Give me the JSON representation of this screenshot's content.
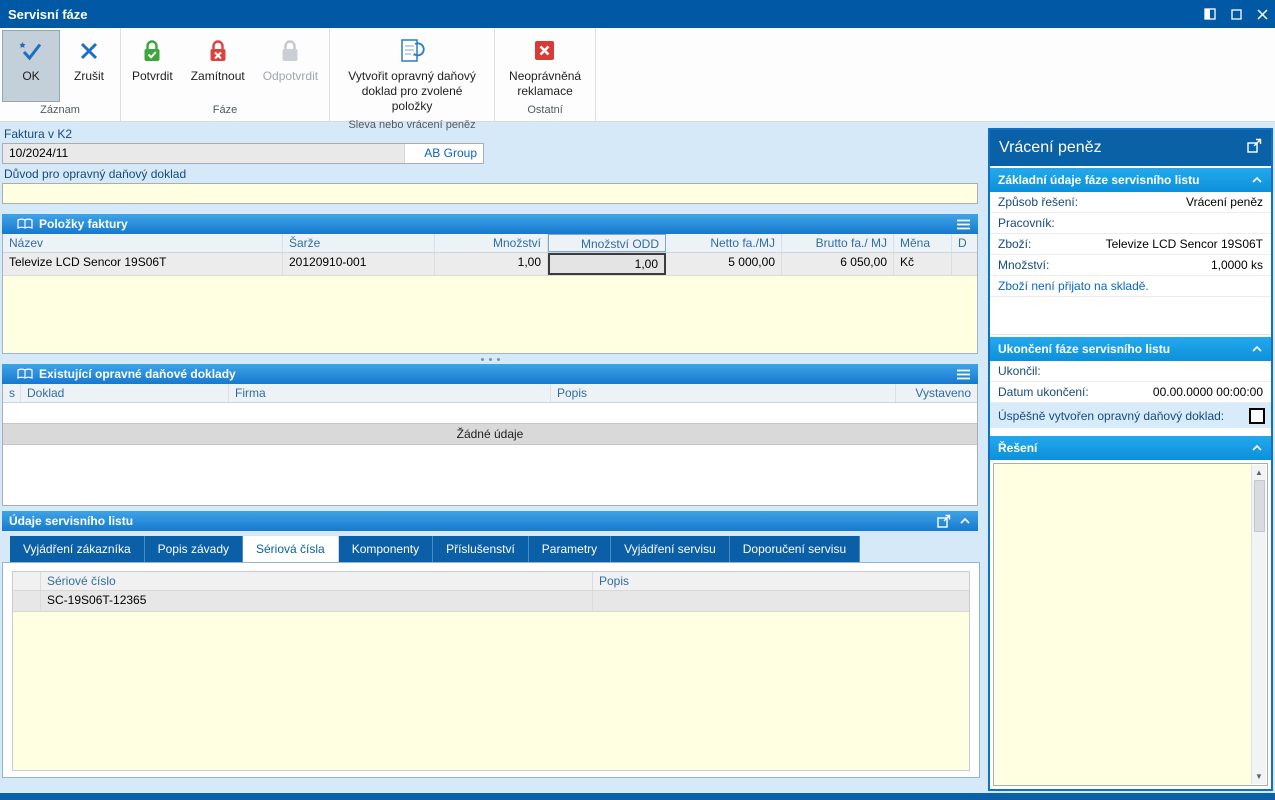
{
  "window": {
    "title": "Servisní fáze"
  },
  "ribbon": {
    "ok": "OK",
    "cancel": "Zrušit",
    "confirm": "Potvrdit",
    "reject": "Zamítnout",
    "unconfirm": "Odpotvrdit",
    "create_doc": "Vytvořit opravný daňový doklad pro zvolené položky",
    "unauthorized": "Neoprávněná reklamace",
    "group_record": "Záznam",
    "group_phase": "Fáze",
    "group_refund": "Sleva nebo vrácení peněz",
    "group_other": "Ostatní"
  },
  "invoice": {
    "label": "Faktura v K2",
    "number": "10/2024/11",
    "company": "AB Group",
    "reason_label": "Důvod pro opravný daňový doklad",
    "reason_value": ""
  },
  "items": {
    "title": "Položky faktury",
    "columns": [
      "Název",
      "Šarže",
      "Množství",
      "Množství ODD",
      "Netto fa./MJ",
      "Brutto fa./ MJ",
      "Měna",
      "D"
    ],
    "row": {
      "name": "Televize LCD Sencor 19S06T",
      "batch": "20120910-001",
      "qty": "1,00",
      "qty_odd": "1,00",
      "netto": "5 000,00",
      "brutto": "6 050,00",
      "currency": "Kč",
      "d": ""
    }
  },
  "existing_docs": {
    "title": "Existující opravné daňové doklady",
    "columns": [
      "s",
      "Doklad",
      "Firma",
      "Popis",
      "Vystaveno"
    ],
    "empty_text": "Žádné údaje"
  },
  "service_sheet": {
    "title": "Údaje servisního listu",
    "tabs": [
      "Vyjádření zákazníka",
      "Popis závady",
      "Sériová čísla",
      "Komponenty",
      "Příslušenství",
      "Parametry",
      "Vyjádření servisu",
      "Doporučení servisu"
    ],
    "active_tab": "Sériová čísla",
    "columns": [
      "Sériové číslo",
      "Popis"
    ],
    "row": {
      "serial": "SC-19S06T-12365",
      "popis": ""
    }
  },
  "refund_panel": {
    "title": "Vrácení peněz",
    "basic": {
      "title": "Základní údaje fáze servisního listu",
      "fields": [
        {
          "label": "Způsob řešení:",
          "value": "Vrácení peněz"
        },
        {
          "label": "Pracovník:",
          "value": ""
        },
        {
          "label": "Zboží:",
          "value": "Televize LCD Sencor 19S06T"
        },
        {
          "label": "Množství:",
          "value": "1,0000 ks"
        }
      ],
      "note": "Zboží není přijato na skladě."
    },
    "closing": {
      "title": "Ukončení fáze servisního listu",
      "fields": [
        {
          "label": "Ukončil:",
          "value": ""
        },
        {
          "label": "Datum ukončení:",
          "value": "00.00.0000 00:00:00"
        }
      ],
      "checkbox_label": "Úspěšně vytvořen opravný daňový doklad:",
      "checkbox_checked": false
    },
    "solution": {
      "title": "Řešení",
      "value": ""
    }
  }
}
